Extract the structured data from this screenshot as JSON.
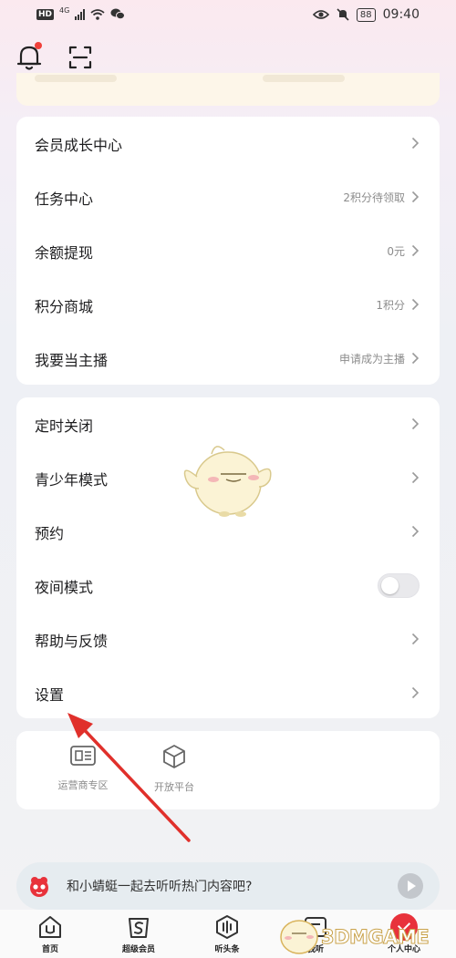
{
  "status_bar": {
    "hd": "HD",
    "network": "4G",
    "battery": "88",
    "time": "09:40"
  },
  "topbar": {
    "notification_icon": "bell-icon",
    "scan_icon": "scan-icon"
  },
  "menu_group_1": [
    {
      "label": "会员成长中心",
      "value": ""
    },
    {
      "label": "任务中心",
      "value": "2积分待领取"
    },
    {
      "label": "余额提现",
      "value": "0元"
    },
    {
      "label": "积分商城",
      "value": "1积分"
    },
    {
      "label": "我要当主播",
      "value": "申请成为主播"
    }
  ],
  "menu_group_2": [
    {
      "label": "定时关闭"
    },
    {
      "label": "青少年模式"
    },
    {
      "label": "预约"
    },
    {
      "label": "夜间模式",
      "toggle": false
    },
    {
      "label": "帮助与反馈"
    },
    {
      "label": "设置"
    }
  ],
  "quick_links": [
    {
      "label": "运营商专区",
      "icon": "sim-card-icon"
    },
    {
      "label": "开放平台",
      "icon": "cube-icon"
    }
  ],
  "promo": {
    "text": "和小蜻蜓一起去听听热门内容吧?"
  },
  "tabbar": [
    {
      "label": "首页",
      "icon": "home-icon"
    },
    {
      "label": "超级会员",
      "icon": "vip-icon"
    },
    {
      "label": "听头条",
      "icon": "headline-icon"
    },
    {
      "label": "我听",
      "icon": "my-listen-icon"
    },
    {
      "label": "个人中心",
      "icon": "profile-icon",
      "active": true
    }
  ],
  "watermark": {
    "text": "3DMGAME"
  },
  "colors": {
    "accent_red": "#e8323b",
    "annotation_arrow": "#e0302b",
    "secondary_text": "#8c8c8c"
  }
}
